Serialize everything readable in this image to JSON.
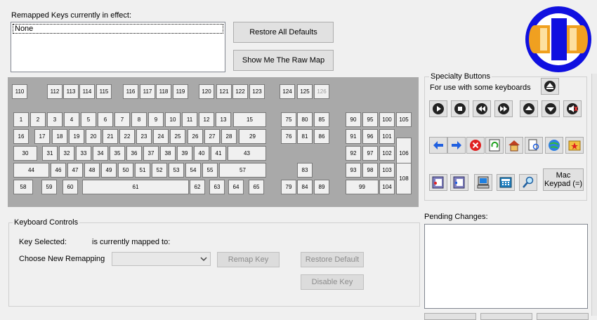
{
  "remapped": {
    "label": "Remapped Keys currently in effect:",
    "items": [
      "None"
    ]
  },
  "buttons": {
    "restore_all": "Restore All Defaults",
    "raw_map": "Show Me The Raw Map"
  },
  "keyboard": {
    "keys": [
      "110",
      "112",
      "113",
      "114",
      "115",
      "116",
      "117",
      "118",
      "119",
      "120",
      "121",
      "122",
      "123",
      "124",
      "125",
      "126",
      "1",
      "2",
      "3",
      "4",
      "5",
      "6",
      "7",
      "8",
      "9",
      "10",
      "11",
      "12",
      "13",
      "15",
      "16",
      "17",
      "18",
      "19",
      "20",
      "21",
      "22",
      "23",
      "24",
      "25",
      "26",
      "27",
      "28",
      "29",
      "30",
      "31",
      "32",
      "33",
      "34",
      "35",
      "36",
      "37",
      "38",
      "39",
      "40",
      "41",
      "43",
      "44",
      "46",
      "47",
      "48",
      "49",
      "50",
      "51",
      "52",
      "53",
      "54",
      "55",
      "57",
      "58",
      "59",
      "60",
      "61",
      "62",
      "63",
      "64",
      "65",
      "75",
      "80",
      "85",
      "76",
      "81",
      "86",
      "83",
      "79",
      "84",
      "89",
      "90",
      "95",
      "100",
      "105",
      "91",
      "96",
      "101",
      "92",
      "97",
      "102",
      "106",
      "93",
      "98",
      "103",
      "99",
      "104",
      "108"
    ]
  },
  "specialty": {
    "title": "Specialty Buttons",
    "subtitle": "For use with some keyboards",
    "mac_keypad": "Mac Keypad (=)",
    "icons": [
      "eject-icon",
      "play-icon",
      "stop-icon",
      "rewind-icon",
      "fast-forward-icon",
      "volume-up-icon",
      "volume-down-icon",
      "mute-icon",
      "back-arrow-icon",
      "forward-arrow-icon",
      "stop-page-icon",
      "refresh-icon",
      "home-icon",
      "search-page-icon",
      "browser-icon",
      "favorites-icon",
      "app-window-1-icon",
      "app-window-2-icon",
      "my-computer-icon",
      "calculator-icon",
      "find-icon"
    ]
  },
  "controls": {
    "title": "Keyboard Controls",
    "key_selected": "Key Selected:",
    "mapped_to": "is currently mapped to:",
    "choose": "Choose New Remapping",
    "remap": "Remap Key",
    "restore_default": "Restore Default",
    "disable": "Disable Key",
    "combo_value": ""
  },
  "pending": {
    "label": "Pending Changes:"
  },
  "colors": {
    "keyboard_bg": "#a9a9a9",
    "logo_blue": "#1010e0",
    "logo_orange": "#f0a020"
  }
}
